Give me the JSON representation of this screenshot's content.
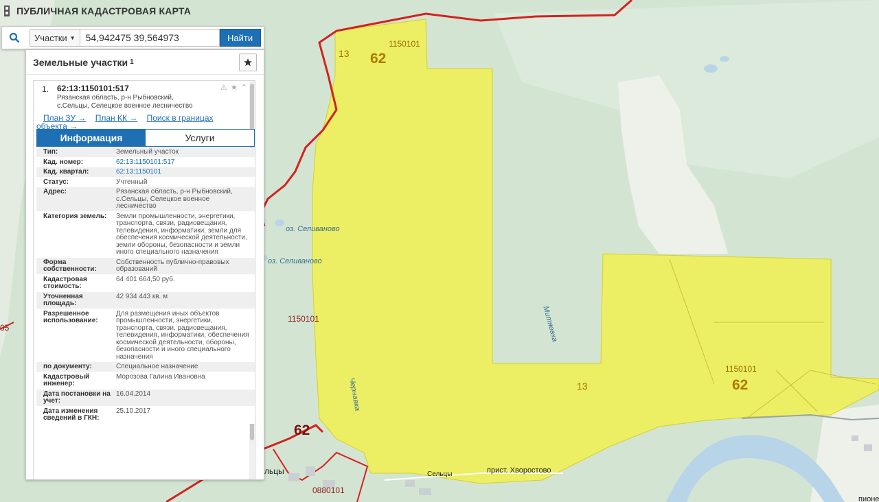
{
  "app": {
    "title": "ПУБЛИЧНАЯ КАДАСТРОВАЯ КАРТА"
  },
  "search": {
    "type_label": "Участки",
    "query": "54,942475 39,564973",
    "button_label": "Найти"
  },
  "panel": {
    "title": "Земельные участки",
    "count": "1",
    "result": {
      "index": "1.",
      "cad_number": "62:13:1150101:517",
      "address": [
        "Рязанская область, р-н Рыбновский,",
        "с.Сельцы, Селецкое военное лесничество"
      ],
      "links": {
        "plan_zu": "План ЗУ →",
        "plan_kk": "План КК →",
        "search_in_bounds": "Поиск в границах",
        "search_in_bounds_2": "объекта →"
      },
      "tabs": {
        "info": "Информация",
        "services": "Услуги"
      },
      "rows": [
        {
          "key": "Тип:",
          "value": "Земельный участок"
        },
        {
          "key": "Кад. номер:",
          "value": "62:13:1150101:517"
        },
        {
          "key": "Кад. квартал:",
          "value": "62:13:1150101"
        },
        {
          "key": "Статус:",
          "value": "Учтенный"
        },
        {
          "key": "Адрес:",
          "value": "Рязанская область, р-н Рыбновский, с.Сельцы, Селецкое военное лесничество"
        },
        {
          "key": "Категория земель:",
          "value": "Земли промышленности, энергетики, транспорта, связи, радиовещания, телевидения, информатики, земли для обеспечения космической деятельности, земли обороны, безопасности и земли иного специального назначения"
        },
        {
          "key": "Форма собственности:",
          "value": "Собственность публично-правовых образований"
        },
        {
          "key": "Кадастровая стоимость:",
          "value": "64 401 664,50 руб."
        },
        {
          "key": "Уточненная площадь:",
          "value": "42 934 443 кв. м"
        },
        {
          "key": "Разрешенное использование:",
          "value": "Для размещения иных объектов промышленности, энергетики, транспорта, связи, радиовещания, телевидения, информатики, обеспечения космической деятельности, обороны, безопасности и иного специального назначения"
        },
        {
          "key": "по документу:",
          "value": "Специальное назначение"
        },
        {
          "key": "Кадастровый инженер:",
          "value": "Морозова Галина Ивановна"
        },
        {
          "key": "Дата постановки на учет:",
          "value": "16.04.2014"
        },
        {
          "key": "Дата изменения сведений в ГКН:",
          "value": "25.10.2017"
        }
      ]
    }
  },
  "map": {
    "labels": {
      "code_13_top": "13",
      "region_62_top": "62",
      "quarter_top": "1150101",
      "quarter_left": "1150101",
      "quarter_right": "1150101",
      "code_13_mid": "13",
      "region_62_right": "62",
      "region_62_bottom": "62",
      "edge_05": "05",
      "quarter_bottom": "0880101",
      "lake_1": "оз. Селиваново",
      "lake_2": "оз. Селиваново",
      "river_chernavka": "Чернавка",
      "river_mityaevka": "Митяевка",
      "place_seltsy": "Сельцы",
      "place_seltsy_2": "льцы",
      "place_pristan": "прист. Хворостово",
      "place_pione": "пионе"
    },
    "colors": {
      "parcel_fill": "#f2f04a",
      "boundary": "#d42020",
      "forest": "#cfe3cf",
      "field": "#eef1ea",
      "water": "#b7d4e8"
    }
  }
}
